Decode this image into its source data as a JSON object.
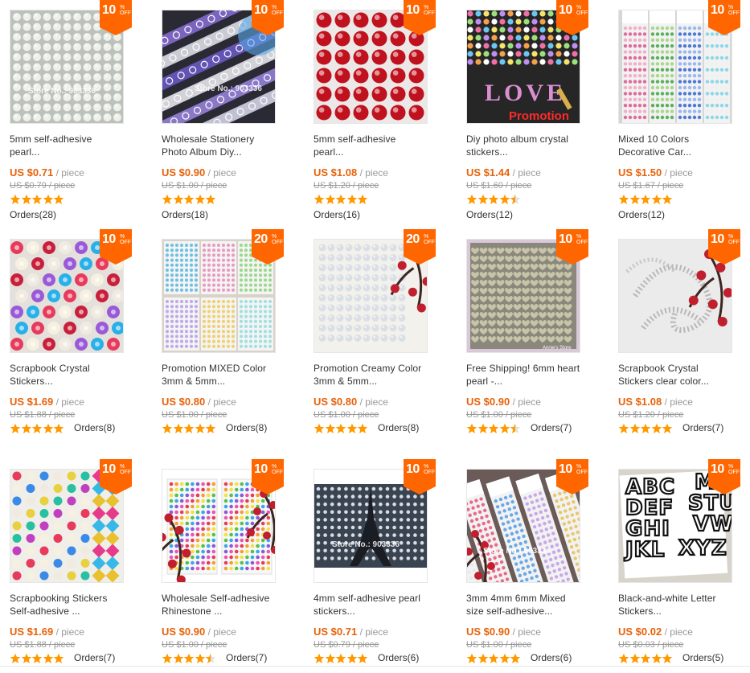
{
  "products": [
    {
      "discount": "10",
      "off_label": "OFF",
      "pct_label": "%",
      "title1": "5mm self-adhesive",
      "title2": "pearl...",
      "price_prefix": "US $",
      "price": "0.71",
      "unit": "/ piece",
      "orig": "US $0.79 / piece",
      "rating": 5,
      "orders": "Orders(28)",
      "orders_inline": false,
      "image": "pearl-grid-white",
      "watermark": "Store No.: 903336"
    },
    {
      "discount": "10",
      "off_label": "OFF",
      "pct_label": "%",
      "title1": "Wholesale Stationery",
      "title2": "Photo Album Diy...",
      "price_prefix": "US $",
      "price": "0.90",
      "unit": "/ piece",
      "orig": "US $1.00 / piece",
      "rating": 5,
      "orders": "Orders(18)",
      "orders_inline": false,
      "image": "lace-tape",
      "watermark": "Store No.: 903336"
    },
    {
      "discount": "10",
      "off_label": "OFF",
      "pct_label": "%",
      "title1": "5mm self-adhesive",
      "title2": "pearl...",
      "price_prefix": "US $",
      "price": "1.08",
      "unit": "/ piece",
      "orig": "US $1.20 / piece",
      "rating": 5,
      "orders": "Orders(16)",
      "orders_inline": false,
      "image": "pearl-grid-red",
      "watermark": ""
    },
    {
      "discount": "10",
      "off_label": "OFF",
      "pct_label": "%",
      "title1": "Diy photo album crystal",
      "title2": "stickers...",
      "price_prefix": "US $",
      "price": "1.44",
      "unit": "/ piece",
      "orig": "US $1.60 / piece",
      "rating": 4.5,
      "orders": "Orders(12)",
      "orders_inline": false,
      "image": "love-crystals",
      "love_text": "LOVE",
      "promo_text": "Promotion"
    },
    {
      "discount": "10",
      "off_label": "OFF",
      "pct_label": "%",
      "title1": "Mixed 10 Colors",
      "title2": "Decorative Car...",
      "price_prefix": "US $",
      "price": "1.50",
      "unit": "/ piece",
      "orig": "US $1.67 / piece",
      "rating": 5,
      "orders": "Orders(12)",
      "orders_inline": false,
      "image": "sheets-colors"
    },
    {
      "discount": "10",
      "off_label": "OFF",
      "pct_label": "%",
      "title1": "Scrapbook Crystal",
      "title2": "Stickers...",
      "price_prefix": "US $",
      "price": "1.69",
      "unit": "/ piece",
      "orig": "US $1.88 / piece",
      "rating": 5,
      "orders": "Orders(8)",
      "orders_inline": true,
      "image": "flowers-gems"
    },
    {
      "discount": "20",
      "off_label": "OFF",
      "pct_label": "%",
      "title1": "Promotion MIXED Color",
      "title2": "3mm & 5mm...",
      "price_prefix": "US $",
      "price": "0.80",
      "unit": "/ piece",
      "orig": "US $1.00 / piece",
      "rating": 5,
      "orders": "Orders(8)",
      "orders_inline": true,
      "image": "mixed-sheets"
    },
    {
      "discount": "20",
      "off_label": "OFF",
      "pct_label": "%",
      "title1": "Promotion Creamy Color",
      "title2": "3mm & 5mm...",
      "price_prefix": "US $",
      "price": "0.80",
      "unit": "/ piece",
      "orig": "US $1.00 / piece",
      "rating": 5,
      "orders": "Orders(8)",
      "orders_inline": true,
      "image": "cream-pearls"
    },
    {
      "discount": "10",
      "off_label": "OFF",
      "pct_label": "%",
      "title1": "Free Shipping! 6mm heart",
      "title2": "pearl -...",
      "price_prefix": "US $",
      "price": "0.90",
      "unit": "/ piece",
      "orig": "US $1.00 / piece",
      "rating": 4.5,
      "orders": "Orders(7)",
      "orders_inline": true,
      "image": "heart-pearls",
      "store_text": "Annie's Store"
    },
    {
      "discount": "10",
      "off_label": "OFF",
      "pct_label": "%",
      "title1": "Scrapbook Crystal",
      "title2": "Stickers clear color...",
      "price_prefix": "US $",
      "price": "1.08",
      "unit": "/ piece",
      "orig": "US $1.20 / piece",
      "rating": 5,
      "orders": "Orders(7)",
      "orders_inline": true,
      "image": "swirl-crystals"
    },
    {
      "discount": "10",
      "off_label": "OFF",
      "pct_label": "%",
      "title1": "Scrapbooking Stickers",
      "title2": "Self-adhesive ...",
      "price_prefix": "US $",
      "price": "1.69",
      "unit": "/ piece",
      "orig": "US $1.88 / piece",
      "rating": 5,
      "orders": "Orders(7)",
      "orders_inline": true,
      "image": "gems-columns"
    },
    {
      "discount": "10",
      "off_label": "OFF",
      "pct_label": "%",
      "title1": "Wholesale Self-adhesive",
      "title2": "Rhinestone ...",
      "price_prefix": "US $",
      "price": "0.90",
      "unit": "/ piece",
      "orig": "US $1.00 / piece",
      "rating": 4.5,
      "orders": "Orders(7)",
      "orders_inline": true,
      "image": "rhinestone-sheets"
    },
    {
      "discount": "10",
      "off_label": "OFF",
      "pct_label": "%",
      "title1": "4mm self-adhesive pearl",
      "title2": "stickers...",
      "price_prefix": "US $",
      "price": "0.71",
      "unit": "/ piece",
      "orig": "US $0.79 / piece",
      "rating": 5,
      "orders": "Orders(6)",
      "orders_inline": true,
      "image": "eiffel-pearls",
      "watermark": "Store No.: 903336"
    },
    {
      "discount": "10",
      "off_label": "OFF",
      "pct_label": "%",
      "title1": "3mm 4mm 6mm Mixed",
      "title2": "size self-adhesive...",
      "price_prefix": "US $",
      "price": "0.90",
      "unit": "/ piece",
      "orig": "US $1.00 / piece",
      "rating": 5,
      "orders": "Orders(6)",
      "orders_inline": true,
      "image": "strip-cards",
      "watermark": "Store No.: 903336"
    },
    {
      "discount": "10",
      "off_label": "OFF",
      "pct_label": "%",
      "title1": "Black-and-white Letter",
      "title2": "Stickers...",
      "price_prefix": "US $",
      "price": "0.02",
      "unit": "/ piece",
      "orig": "US $0.03 / piece",
      "rating": 5,
      "orders": "Orders(5)",
      "orders_inline": true,
      "image": "letters",
      "letters": "ABC MN DEF STU GHI VW JKL XYZ"
    }
  ],
  "colors": {
    "badge": "#ff6600",
    "price": "#e8620a",
    "star": "#ff9900"
  }
}
